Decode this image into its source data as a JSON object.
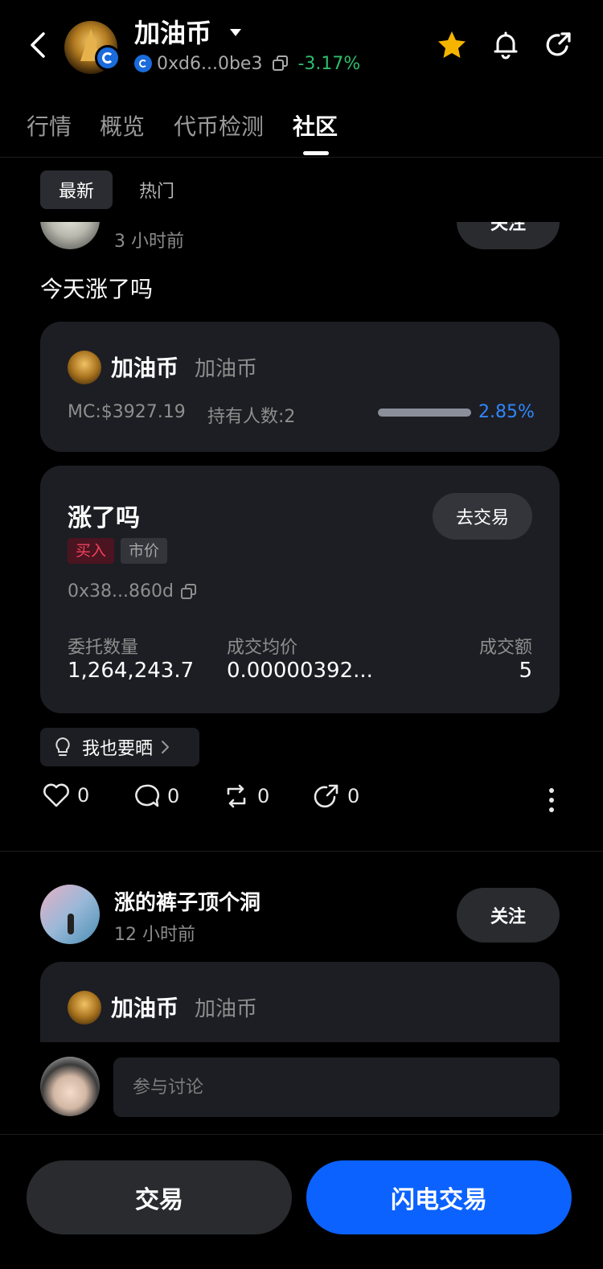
{
  "header": {
    "token_name": "加油币",
    "address": "0xd6...0be3",
    "change": "-3.17%",
    "colors": {
      "change": "#2ebd6b",
      "star": "#f5b400"
    }
  },
  "tabs": [
    {
      "label": "行情"
    },
    {
      "label": "概览"
    },
    {
      "label": "代币检测"
    },
    {
      "label": "社区"
    }
  ],
  "filters": {
    "latest": "最新",
    "hot": "热门"
  },
  "post1": {
    "follow_label": "关注",
    "time": "3 小时前",
    "text": "今天涨了吗",
    "coin": {
      "name": "加油币",
      "symbol": "加油币",
      "mc": "MC:$3927.19",
      "holders": "持有人数:2",
      "progress_text": "2.85%",
      "progress": 0.0285
    },
    "trade": {
      "title": "涨了吗",
      "go_trade": "去交易",
      "tag_buy": "买入",
      "tag_market": "市价",
      "address": "0x38...860d",
      "qty_label": "委托数量",
      "qty_value": "1,264,243.7",
      "avg_label": "成交均价",
      "avg_value": "0.00000392...",
      "amt_label": "成交额",
      "amt_value": "5"
    },
    "share_chip": "我也要晒",
    "actions": {
      "likes": "0",
      "comments": "0",
      "reposts": "0",
      "shares": "0"
    }
  },
  "post2": {
    "username": "涨的裤子顶个洞",
    "time": "12 小时前",
    "follow_label": "关注",
    "coin": {
      "name": "加油币",
      "symbol": "加油币"
    }
  },
  "comment": {
    "placeholder": "参与讨论"
  },
  "bottom": {
    "trade": "交易",
    "flash_trade": "闪电交易"
  }
}
